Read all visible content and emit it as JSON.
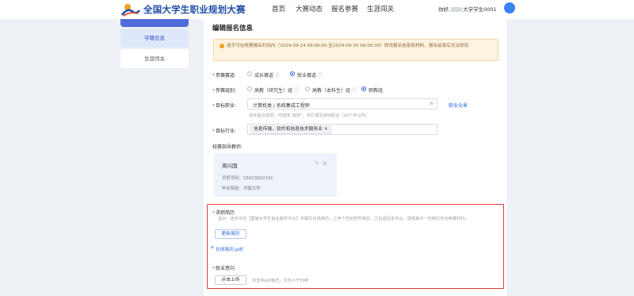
{
  "header": {
    "logo_text": "全国大学生职业规划大赛",
    "nav": [
      "首页",
      "大赛动态",
      "报名参赛",
      "生涯闯关"
    ],
    "user_prefix": "你好,",
    "user_suffix": "大学学生0001"
  },
  "sidebar": {
    "items": [
      {
        "label": "学籍信息"
      },
      {
        "label": "生涯闯关"
      }
    ]
  },
  "form": {
    "title": "编辑报名信息",
    "notice": "选手可在校赛报名时间内（2024-09-24 09:00:00 至2024-09-30 09:00:00）修改报名信息和材料，报名结束后无法修改",
    "track": {
      "label": "参赛赛道:",
      "options": [
        "成长赛道",
        "就业赛道"
      ],
      "selected": "就业赛道"
    },
    "group": {
      "label": "参赛组别:",
      "options": [
        "高教（研究生）组",
        "高教（本科生）组",
        "职教组"
      ],
      "selected": "职教组"
    },
    "job": {
      "label": "目标职业:",
      "value": "计算机类 / 系统集成工程师",
      "link": "职业全景",
      "hint": "如无适合选项，可选择“其他”，自行填写目标职业（10个字以内）"
    },
    "industry": {
      "label": "目标行业:",
      "tag": "信息传输、软件和信息技术服务业"
    },
    "mentor": {
      "label": "校赛指导教师:",
      "name": "周兴国",
      "phone": "手机号码：15623832191",
      "school": "毕业院校：济南大学"
    },
    "resume": {
      "label": "求职简历",
      "desc": "提示：选手可在【国家大学生就业服务平台】中填写在线简历，上传个性化附件简历，之后返回本平台，选择其中一份简历作为参赛材料。",
      "button": "更新简历",
      "file": "在线简历.pdf"
    },
    "report": {
      "label": "就业意向",
      "button": "点击上传",
      "hint": "仅支持pdf格式，文件小于50M"
    }
  },
  "colors": {
    "accent": "#2d64e0",
    "brand": "#1f4ea8",
    "highlight_border": "#e23a3a",
    "notice_bg": "#fdf3e0"
  }
}
